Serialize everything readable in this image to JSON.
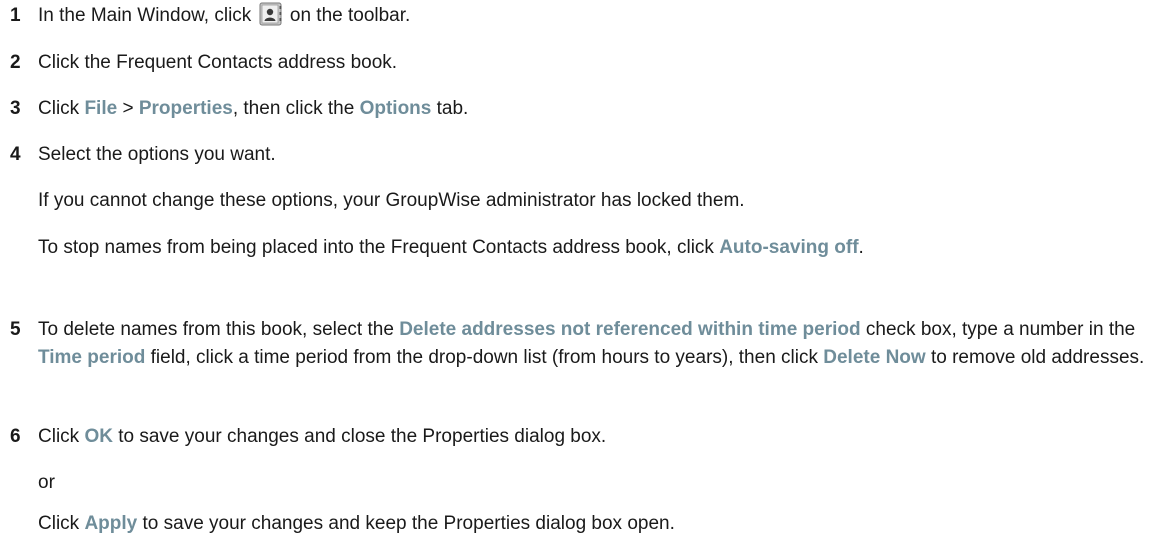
{
  "steps": [
    {
      "num": "1",
      "text_before": "In the Main Window, click",
      "text_after": "on the toolbar.",
      "icon": "address-book-icon"
    },
    {
      "num": "2",
      "text": "Click the Frequent Contacts address book."
    },
    {
      "num": "3",
      "t1": "Click",
      "ui1": "File",
      "t2": ">",
      "ui2": "Properties",
      "t3": ", then click the",
      "ui3": "Options",
      "t4": "tab."
    },
    {
      "num": "4",
      "text": "Select the options you want."
    },
    {
      "num": "5",
      "t1": "To delete names from this book, select the",
      "ui1": "Delete addresses not referenced within time period",
      "t2": "check box, type a number in the",
      "ui2": "Time period",
      "t3": "field, click a time period from the drop-down list (from hours to years), then click",
      "ui3": "Delete Now",
      "t4": "to remove old addresses."
    },
    {
      "num": "6",
      "t1": "Click",
      "ui1": "OK",
      "t2": "to save your changes and close the Properties dialog box."
    }
  ],
  "step4_notes": {
    "note1": "If you cannot change these options, your GroupWise administrator has locked them.",
    "note2_text": "To stop names from being placed into the Frequent Contacts address book, click",
    "note2_ui": "Auto-saving off",
    "note2_end": "."
  },
  "step6_alt": {
    "or": "or",
    "t1": "Click",
    "ui1": "Apply",
    "t2": "to save your changes and keep the Properties dialog box open."
  }
}
